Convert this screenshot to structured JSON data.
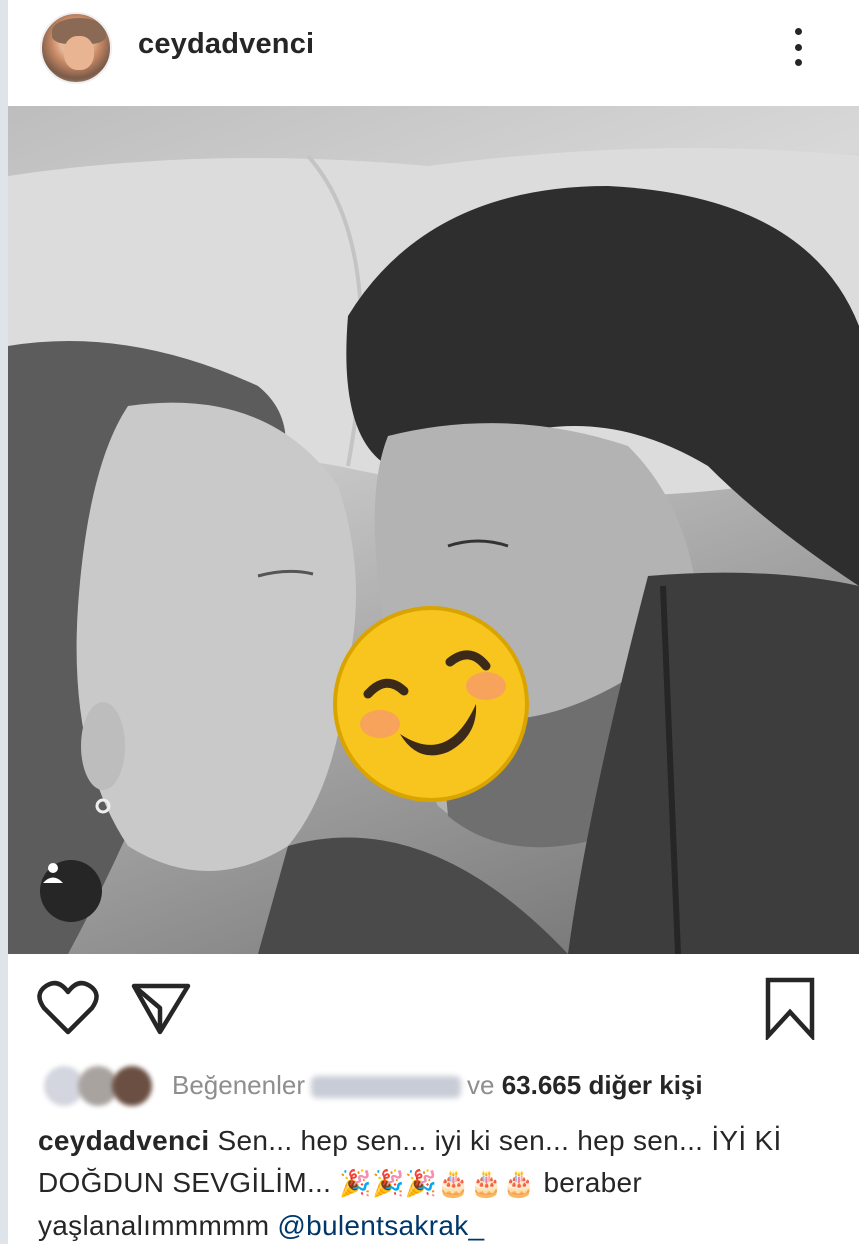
{
  "post": {
    "username": "ceydadvenci",
    "more_icon": "vertical-dots-icon",
    "tag_icon": "user-tag-icon"
  },
  "actions": {
    "like_icon": "heart-outline-icon",
    "share_icon": "paper-plane-icon",
    "save_icon": "bookmark-outline-icon"
  },
  "likes": {
    "prefix": "Beğenenler",
    "connector": "ve",
    "count_text": "63.665 diğer kişi"
  },
  "caption": {
    "username": "ceydadvenci",
    "text": " Sen... hep sen... iyi ki sen... hep sen... İYİ Kİ DOĞDUN SEVGİLİM... ",
    "emojis": "🎉🎉🎉🎂🎂🎂",
    "text_after": " beraber yaşlanalımmmmm ",
    "mention": "@bulentsakrak_"
  },
  "colors": {
    "text": "#262626",
    "muted": "#8e8e8e",
    "mention": "#00376b"
  }
}
